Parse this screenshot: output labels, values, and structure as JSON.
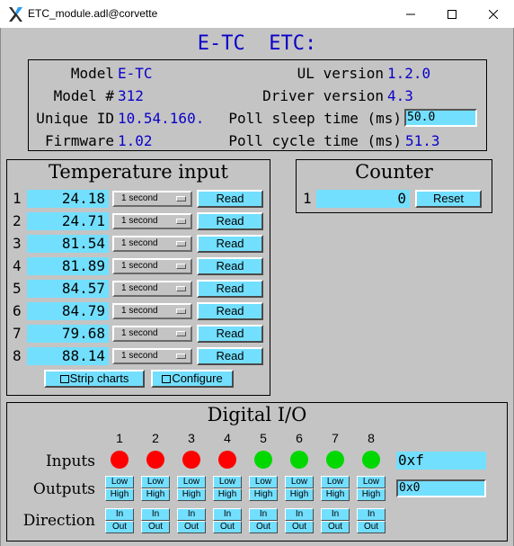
{
  "window": {
    "title": "ETC_module.adl@corvette"
  },
  "header": {
    "title": "E-TC  ETC:"
  },
  "info": {
    "model_label": "Model",
    "model_value": "E-TC",
    "model_num_label": "Model #",
    "model_num_value": "312",
    "unique_id_label": "Unique ID",
    "unique_id_value": "10.54.160.",
    "firmware_label": "Firmware",
    "firmware_value": "1.02",
    "ul_version_label": "UL version",
    "ul_version_value": "1.2.0",
    "driver_version_label": "Driver version",
    "driver_version_value": "4.3",
    "poll_sleep_label": "Poll sleep time (ms)",
    "poll_sleep_value": "50.0",
    "poll_cycle_label": "Poll cycle time (ms)",
    "poll_cycle_value": "51.3"
  },
  "temperature": {
    "title": "Temperature input",
    "rows": [
      {
        "num": "1",
        "value": "24.18",
        "rate": "1 second",
        "read": "Read"
      },
      {
        "num": "2",
        "value": "24.71",
        "rate": "1 second",
        "read": "Read"
      },
      {
        "num": "3",
        "value": "81.54",
        "rate": "1 second",
        "read": "Read"
      },
      {
        "num": "4",
        "value": "81.89",
        "rate": "1 second",
        "read": "Read"
      },
      {
        "num": "5",
        "value": "84.57",
        "rate": "1 second",
        "read": "Read"
      },
      {
        "num": "6",
        "value": "84.79",
        "rate": "1 second",
        "read": "Read"
      },
      {
        "num": "7",
        "value": "79.68",
        "rate": "1 second",
        "read": "Read"
      },
      {
        "num": "8",
        "value": "88.14",
        "rate": "1 second",
        "read": "Read"
      }
    ],
    "strip_charts": "Strip charts",
    "configure": "Configure"
  },
  "counter": {
    "title": "Counter",
    "num": "1",
    "value": "0",
    "reset": "Reset"
  },
  "digital": {
    "title": "Digital I/O",
    "inputs_label": "Inputs",
    "outputs_label": "Outputs",
    "direction_label": "Direction",
    "channels": [
      "1",
      "2",
      "3",
      "4",
      "5",
      "6",
      "7",
      "8"
    ],
    "input_states": [
      "red",
      "red",
      "red",
      "red",
      "green",
      "green",
      "green",
      "green"
    ],
    "low": "Low",
    "high": "High",
    "in": "In",
    "out": "Out",
    "inputs_value": "0xf",
    "outputs_value": "0x0"
  },
  "colors": {
    "led_on": "#00d800",
    "led_off": "#ff0000",
    "field": "#73dfff",
    "value_text": "#0b00c8"
  }
}
